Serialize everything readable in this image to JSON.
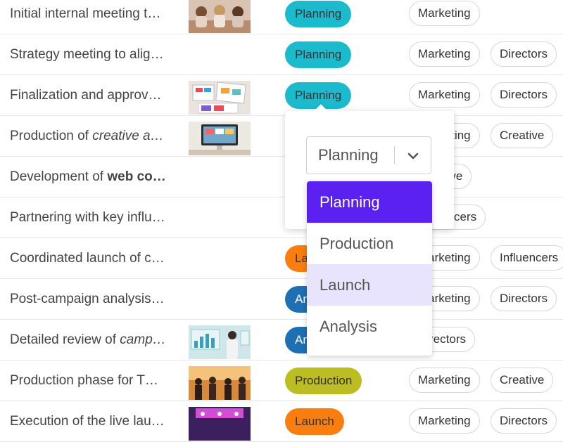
{
  "colors": {
    "planning": "#1bbacc",
    "production": "#bcbd22",
    "launch": "#f97d0f",
    "analysis": "#1f6fb5",
    "menu_selected": "#5b21f0",
    "menu_hover": "#e9e4fd"
  },
  "rows": [
    {
      "title": "Initial internal meeting t…",
      "status": "Planning",
      "tags": [
        "Marketing"
      ]
    },
    {
      "title": "Strategy meeting to alig…",
      "status": "Planning",
      "tags": [
        "Marketing",
        "Directors"
      ]
    },
    {
      "title": "Finalization and approv…",
      "status": "Planning",
      "tags": [
        "Marketing",
        "Directors"
      ]
    },
    {
      "title_pre": "Production of ",
      "title_em": "creative a…",
      "status": "",
      "tags": [
        "Marketing",
        "Creative"
      ]
    },
    {
      "title_pre": "Development of ",
      "title_strong": "web co…",
      "status": "",
      "tags": [
        "Creative"
      ]
    },
    {
      "title": "Partnering with key influ…",
      "status": "",
      "tags": [
        "Influencers"
      ]
    },
    {
      "title": "Coordinated launch of c…",
      "status": "La",
      "tags": [
        "Marketing",
        "Influencers"
      ]
    },
    {
      "title": "Post-campaign analysis…",
      "status": "An",
      "tags": [
        "Marketing",
        "Directors"
      ]
    },
    {
      "title_pre": "Detailed review of ",
      "title_em": "camp…",
      "status": "An",
      "tags": [
        "Directors"
      ]
    },
    {
      "title": "Production phase for T…",
      "status": "Production",
      "tags": [
        "Marketing",
        "Creative"
      ]
    },
    {
      "title": "Execution of the live lau…",
      "status": "Launch",
      "tags": [
        "Marketing",
        "Directors"
      ]
    }
  ],
  "popover": {
    "select_value": "Planning",
    "options": [
      "Planning",
      "Production",
      "Launch",
      "Analysis"
    ],
    "selected_index": 0,
    "hover_index": 2
  }
}
